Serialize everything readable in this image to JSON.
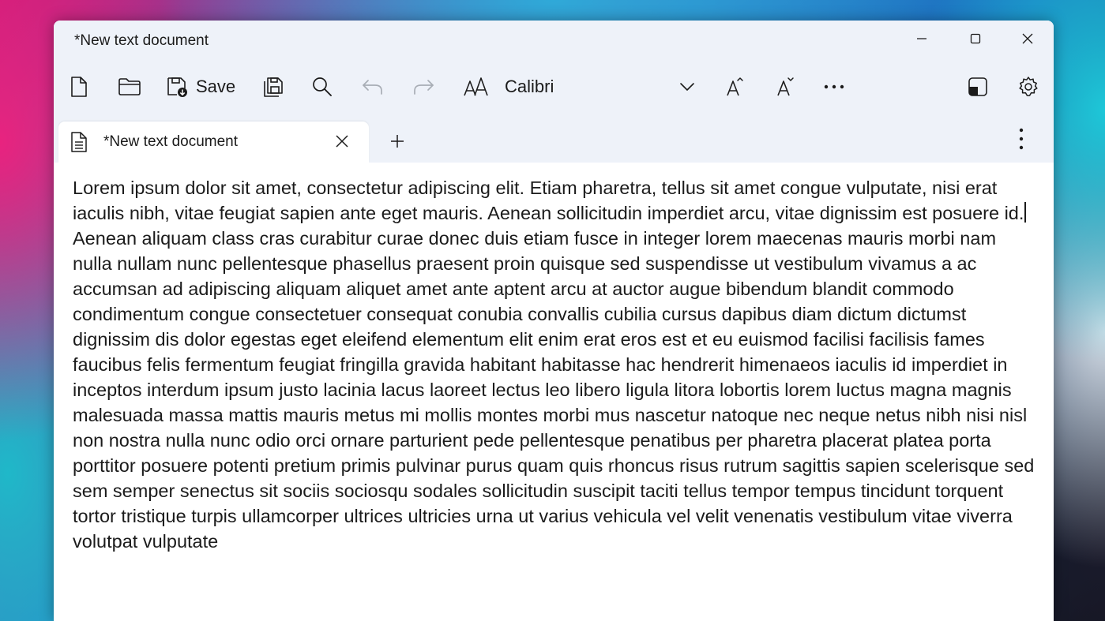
{
  "window": {
    "title": "*New text document"
  },
  "toolbar": {
    "save_label": "Save",
    "font_name": "Calibri"
  },
  "tabs": [
    {
      "label": "*New text document",
      "active": true
    }
  ],
  "editor": {
    "paragraph_1": "Lorem ipsum dolor sit amet, consectetur adipiscing elit. Etiam pharetra, tellus sit amet congue vulputate, nisi erat iaculis nibh, vitae feugiat sapien ante eget mauris. Aenean sollicitudin imperdiet arcu, vitae dignissim est posuere id.",
    "paragraph_2": "Aenean aliquam class cras curabitur curae donec duis etiam fusce in integer lorem maecenas mauris morbi nam nulla nullam nunc pellentesque phasellus praesent proin quisque sed suspendisse ut vestibulum vivamus a ac accumsan ad adipiscing aliquam aliquet amet ante aptent arcu at auctor augue bibendum blandit commodo condimentum congue consectetuer consequat conubia convallis cubilia cursus dapibus diam dictum dictumst dignissim dis dolor egestas eget eleifend elementum elit enim erat eros est et eu euismod facilisi facilisis fames faucibus felis fermentum feugiat fringilla gravida habitant habitasse hac hendrerit himenaeos iaculis id imperdiet in inceptos interdum ipsum justo lacinia lacus laoreet lectus leo libero ligula litora lobortis lorem luctus magna magnis malesuada massa mattis mauris metus mi mollis montes morbi mus nascetur natoque nec neque netus nibh nisi nisl non nostra nulla nunc odio orci ornare parturient pede pellentesque penatibus per pharetra placerat platea porta porttitor posuere potenti pretium primis pulvinar purus quam quis rhoncus risus rutrum sagittis sapien scelerisque sed sem semper senectus sit sociis sociosqu sodales sollicitudin suscipit taciti tellus tempor tempus tincidunt torquent tortor tristique turpis ullamcorper ultrices ultricies urna ut varius vehicula vel velit venenatis vestibulum vitae viverra volutpat vulputate"
  },
  "icons": {
    "new": "new-file-icon",
    "open": "folder-icon",
    "save": "save-icon",
    "save_as": "save-as-icon",
    "find": "search-icon",
    "undo": "undo-icon",
    "redo": "redo-icon",
    "font": "font-icon",
    "font_dropdown": "chevron-down-icon",
    "increase_font": "increase-font-size-icon",
    "decrease_font": "decrease-font-size-icon",
    "more": "more-icon",
    "compact": "compact-overlay-icon",
    "settings": "gear-icon"
  }
}
